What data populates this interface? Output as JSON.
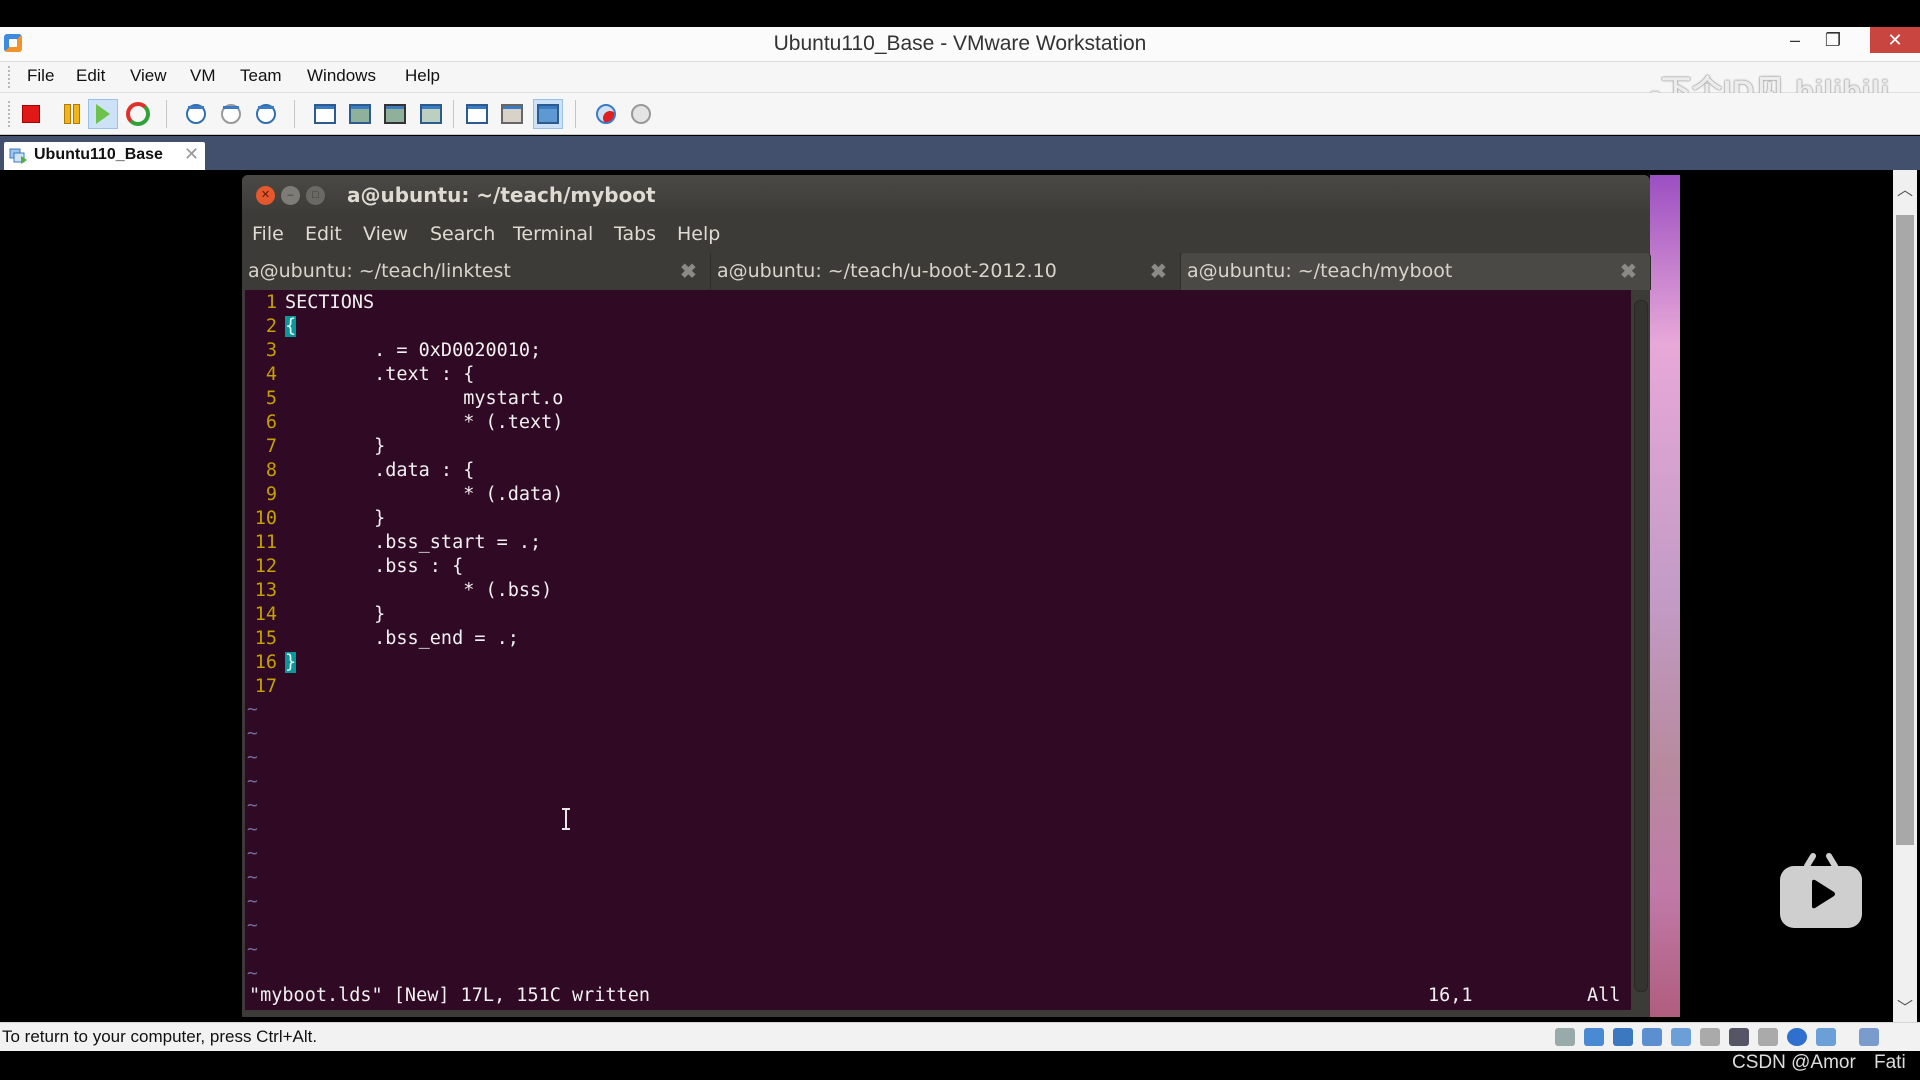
{
  "window": {
    "title": "Ubuntu110_Base - VMware Workstation",
    "minimize": "–",
    "maximize": "❐",
    "close": "✕"
  },
  "menubar": [
    "File",
    "Edit",
    "View",
    "VM",
    "Team",
    "Windows",
    "Help"
  ],
  "toolbar": {
    "buttons": [
      "power-off",
      "suspend",
      "power-on",
      "reset",
      "take-snapshot",
      "revert-snapshot",
      "snapshot-manager",
      "show-sidebar",
      "quick-switch",
      "full-screen",
      "unity",
      "vm-settings",
      "console-view",
      "thumbnail-bar",
      "record",
      "replay"
    ],
    "active": [
      "power-on",
      "thumbnail-bar"
    ]
  },
  "watermark": "-下个ID见 bilibili",
  "vm_tab": {
    "label": "Ubuntu110_Base",
    "close": "✕"
  },
  "terminal": {
    "title": "a@ubuntu: ~/teach/myboot",
    "menu": [
      "File",
      "Edit",
      "View",
      "Search",
      "Terminal",
      "Tabs",
      "Help"
    ],
    "tabs": [
      {
        "label": "a@ubuntu: ~/teach/linktest",
        "active": false
      },
      {
        "label": "a@ubuntu: ~/teach/u-boot-2012.10",
        "active": false
      },
      {
        "label": "a@ubuntu: ~/teach/myboot",
        "active": true
      }
    ],
    "tab_close": "✖",
    "editor": {
      "lines": [
        {
          "n": "1",
          "text": "SECTIONS"
        },
        {
          "n": "2",
          "text": "{"
        },
        {
          "n": "3",
          "text": "        . = 0xD0020010;"
        },
        {
          "n": "4",
          "text": "        .text : {"
        },
        {
          "n": "5",
          "text": "                mystart.o"
        },
        {
          "n": "6",
          "text": "                * (.text)"
        },
        {
          "n": "7",
          "text": "        }"
        },
        {
          "n": "8",
          "text": "        .data : {"
        },
        {
          "n": "9",
          "text": "                * (.data)"
        },
        {
          "n": "10",
          "text": "        }"
        },
        {
          "n": "11",
          "text": "        .bss_start = .;"
        },
        {
          "n": "12",
          "text": "        .bss : {"
        },
        {
          "n": "13",
          "text": "                * (.bss)"
        },
        {
          "n": "14",
          "text": "        }"
        },
        {
          "n": "15",
          "text": "        .bss_end = .;"
        },
        {
          "n": "16",
          "text": "}"
        },
        {
          "n": "17",
          "text": ""
        }
      ],
      "tilde": "~",
      "tilde_count": 12,
      "status_message": "\"myboot.lds\" [New] 17L, 151C written",
      "cursor_position": "16,1",
      "scroll_position": "All"
    }
  },
  "statusbar": {
    "text": "To return to your computer, press Ctrl+Alt.",
    "devices": [
      "hard-disk",
      "network",
      "sound",
      "printer",
      "usb",
      "keyboard",
      "display",
      "keyboard-2",
      "bluetooth",
      "usb-2",
      "message"
    ]
  },
  "credit": {
    "left": "CSDN @Amor",
    "right": "Fati"
  }
}
